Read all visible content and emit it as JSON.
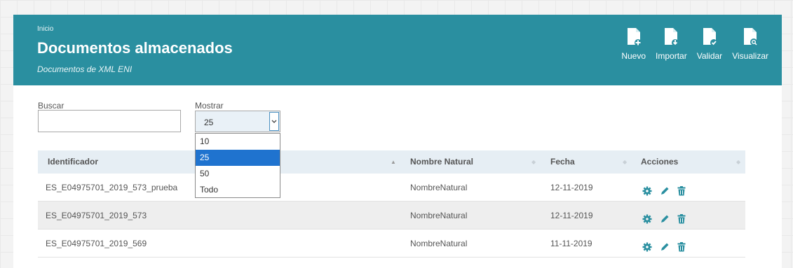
{
  "header": {
    "breadcrumb": "Inicio",
    "title": "Documentos almacenados",
    "subtitle": "Documentos de XML ENI",
    "background_color": "#2a8fa0",
    "actions": [
      {
        "label": "Nuevo",
        "icon": "document-add-icon"
      },
      {
        "label": "Importar",
        "icon": "document-import-icon"
      },
      {
        "label": "Validar",
        "icon": "document-validate-icon"
      },
      {
        "label": "Visualizar",
        "icon": "document-view-icon"
      }
    ]
  },
  "filters": {
    "search_label": "Buscar",
    "search_value": "",
    "show_label": "Mostrar",
    "show_selected": "25",
    "show_options": [
      "10",
      "25",
      "50",
      "Todo"
    ],
    "dropdown_highlight_color": "#1f73cf"
  },
  "table": {
    "columns": [
      "Identificador",
      "Nombre Natural",
      "Fecha",
      "Acciones"
    ],
    "sorted_column": "Identificador",
    "rows": [
      {
        "identificador": "ES_E04975701_2019_573_prueba",
        "nombre": "NombreNatural",
        "fecha": "12-11-2019"
      },
      {
        "identificador": "ES_E04975701_2019_573",
        "nombre": "NombreNatural",
        "fecha": "12-11-2019"
      },
      {
        "identificador": "ES_E04975701_2019_569",
        "nombre": "NombreNatural",
        "fecha": "11-11-2019"
      }
    ],
    "row_actions": [
      "gear-icon",
      "pencil-icon",
      "trash-icon"
    ],
    "action_icon_color": "#2a8fa0"
  }
}
